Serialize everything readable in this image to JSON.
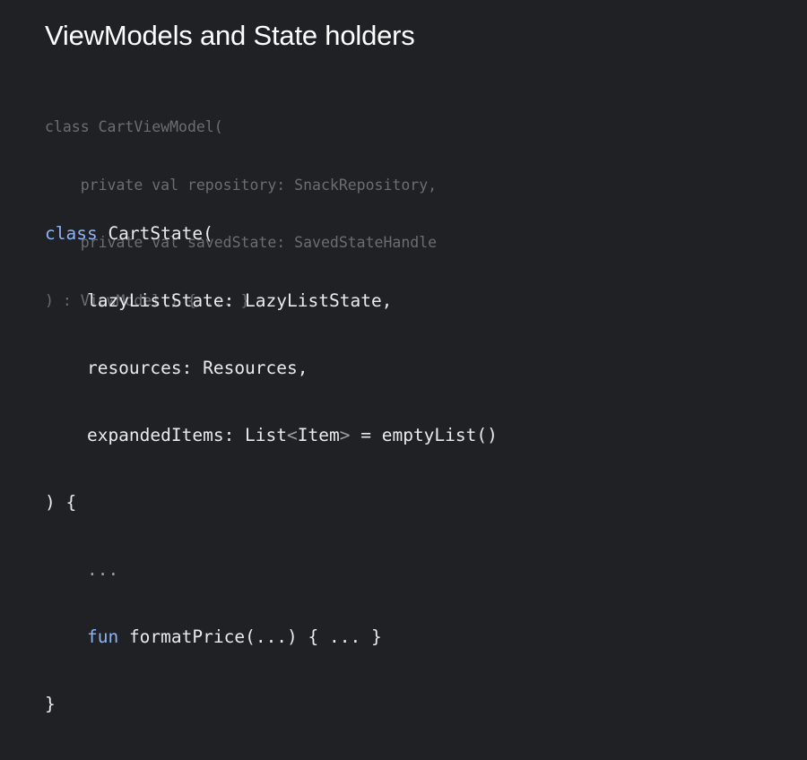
{
  "slide": {
    "title": "ViewModels and State holders"
  },
  "code_muted": {
    "line1_kw": "class",
    "line1_rest": " CartViewModel(",
    "line2": "    private val repository: SnackRepository,",
    "line3": "    private val savedState: SavedStateHandle",
    "line4": ") : ViewModel() { ... }"
  },
  "code_main": {
    "kw_class": "class",
    "class_name": " CartState(",
    "param1": "    lazyListState: LazyListState,",
    "param2": "    resources: Resources,",
    "param3_a": "    expandedItems: List",
    "param3_lt": "<",
    "param3_type": "Item",
    "param3_gt": ">",
    "param3_b": " = emptyList()",
    "close_paren": ") {",
    "ellipsis": "    ...",
    "indent": "    ",
    "kw_fun": "fun",
    "fun_rest": " formatPrice(...) { ... }",
    "close_brace": "}"
  },
  "colors": {
    "background": "#202124",
    "title": "#ffffff",
    "keyword": "#8ab4f8",
    "muted_code": "#6c6d70",
    "main_code": "#e8eaed"
  }
}
